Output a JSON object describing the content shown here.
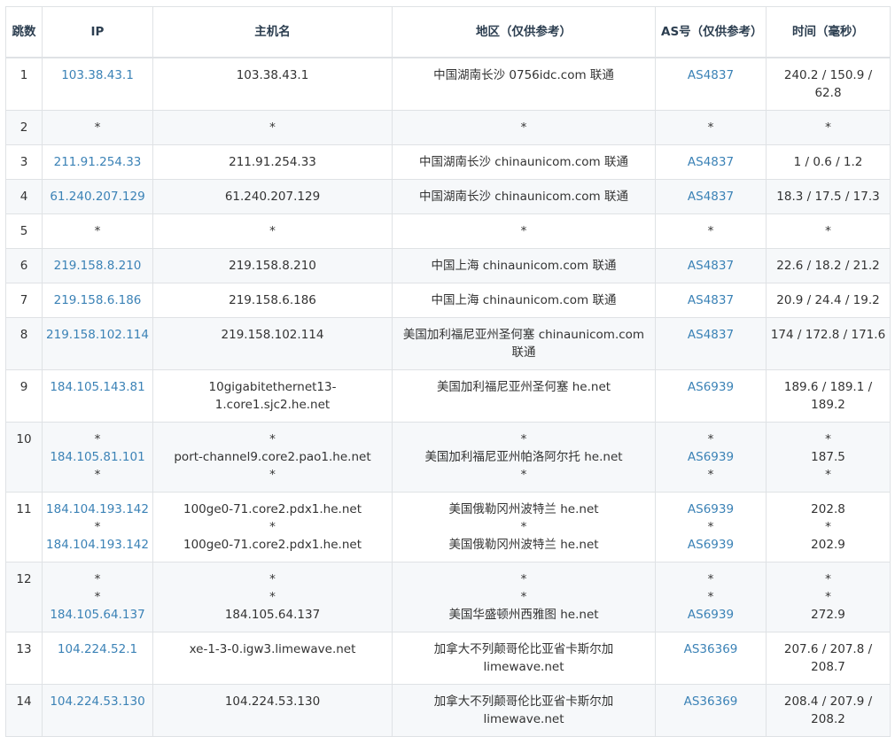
{
  "headers": {
    "hop": "跳数",
    "ip": "IP",
    "hostname": "主机名",
    "region": "地区（仅供参考）",
    "asn": "AS号（仅供参考）",
    "time": "时间（毫秒）"
  },
  "rows": [
    {
      "hop": "1",
      "ip": [
        "103.38.43.1"
      ],
      "hostname": [
        "103.38.43.1"
      ],
      "region": [
        "中国湖南长沙 0756idc.com 联通"
      ],
      "asn": [
        "AS4837"
      ],
      "time": [
        "240.2 / 150.9 / 62.8"
      ]
    },
    {
      "hop": "2",
      "ip": [
        "*"
      ],
      "hostname": [
        "*"
      ],
      "region": [
        "*"
      ],
      "asn": [
        "*"
      ],
      "time": [
        "*"
      ]
    },
    {
      "hop": "3",
      "ip": [
        "211.91.254.33"
      ],
      "hostname": [
        "211.91.254.33"
      ],
      "region": [
        "中国湖南长沙 chinaunicom.com 联通"
      ],
      "asn": [
        "AS4837"
      ],
      "time": [
        "1 / 0.6 / 1.2"
      ]
    },
    {
      "hop": "4",
      "ip": [
        "61.240.207.129"
      ],
      "hostname": [
        "61.240.207.129"
      ],
      "region": [
        "中国湖南长沙 chinaunicom.com 联通"
      ],
      "asn": [
        "AS4837"
      ],
      "time": [
        "18.3 / 17.5 / 17.3"
      ]
    },
    {
      "hop": "5",
      "ip": [
        "*"
      ],
      "hostname": [
        "*"
      ],
      "region": [
        "*"
      ],
      "asn": [
        "*"
      ],
      "time": [
        "*"
      ]
    },
    {
      "hop": "6",
      "ip": [
        "219.158.8.210"
      ],
      "hostname": [
        "219.158.8.210"
      ],
      "region": [
        "中国上海 chinaunicom.com 联通"
      ],
      "asn": [
        "AS4837"
      ],
      "time": [
        "22.6 / 18.2 / 21.2"
      ]
    },
    {
      "hop": "7",
      "ip": [
        "219.158.6.186"
      ],
      "hostname": [
        "219.158.6.186"
      ],
      "region": [
        "中国上海 chinaunicom.com 联通"
      ],
      "asn": [
        "AS4837"
      ],
      "time": [
        "20.9 / 24.4 / 19.2"
      ]
    },
    {
      "hop": "8",
      "ip": [
        "219.158.102.114"
      ],
      "hostname": [
        "219.158.102.114"
      ],
      "region": [
        "美国加利福尼亚州圣何塞 chinaunicom.com 联通"
      ],
      "asn": [
        "AS4837"
      ],
      "time": [
        "174 / 172.8 / 171.6"
      ]
    },
    {
      "hop": "9",
      "ip": [
        "184.105.143.81"
      ],
      "hostname": [
        "10gigabitethernet13-1.core1.sjc2.he.net"
      ],
      "region": [
        "美国加利福尼亚州圣何塞 he.net"
      ],
      "asn": [
        "AS6939"
      ],
      "time": [
        "189.6 / 189.1 / 189.2"
      ]
    },
    {
      "hop": "10",
      "ip": [
        "*",
        "184.105.81.101",
        "*"
      ],
      "hostname": [
        "*",
        "port-channel9.core2.pao1.he.net",
        "*"
      ],
      "region": [
        "*",
        "美国加利福尼亚州帕洛阿尔托 he.net",
        "*"
      ],
      "asn": [
        "*",
        "AS6939",
        "*"
      ],
      "time": [
        "*",
        "187.5",
        "*"
      ]
    },
    {
      "hop": "11",
      "ip": [
        "184.104.193.142",
        "*",
        "184.104.193.142"
      ],
      "hostname": [
        "100ge0-71.core2.pdx1.he.net",
        "*",
        "100ge0-71.core2.pdx1.he.net"
      ],
      "region": [
        "美国俄勒冈州波特兰 he.net",
        "*",
        "美国俄勒冈州波特兰 he.net"
      ],
      "asn": [
        "AS6939",
        "*",
        "AS6939"
      ],
      "time": [
        "202.8",
        "*",
        "202.9"
      ]
    },
    {
      "hop": "12",
      "ip": [
        "*",
        "*",
        "184.105.64.137"
      ],
      "hostname": [
        "*",
        "*",
        "184.105.64.137"
      ],
      "region": [
        "*",
        "*",
        "美国华盛顿州西雅图 he.net"
      ],
      "asn": [
        "*",
        "*",
        "AS6939"
      ],
      "time": [
        "*",
        "*",
        "272.9"
      ]
    },
    {
      "hop": "13",
      "ip": [
        "104.224.52.1"
      ],
      "hostname": [
        "xe-1-3-0.igw3.limewave.net"
      ],
      "region": [
        "加拿大不列颠哥伦比亚省卡斯尔加 limewave.net"
      ],
      "asn": [
        "AS36369"
      ],
      "time": [
        "207.6 / 207.8 / 208.7"
      ]
    },
    {
      "hop": "14",
      "ip": [
        "104.224.53.130"
      ],
      "hostname": [
        "104.224.53.130"
      ],
      "region": [
        "加拿大不列颠哥伦比亚省卡斯尔加 limewave.net"
      ],
      "asn": [
        "AS36369"
      ],
      "time": [
        "208.4 / 207.9 / 208.2"
      ]
    }
  ],
  "colors": {
    "link": "#3b82b6",
    "stripe": "#f6f8fa",
    "border": "#dfe2e5"
  }
}
